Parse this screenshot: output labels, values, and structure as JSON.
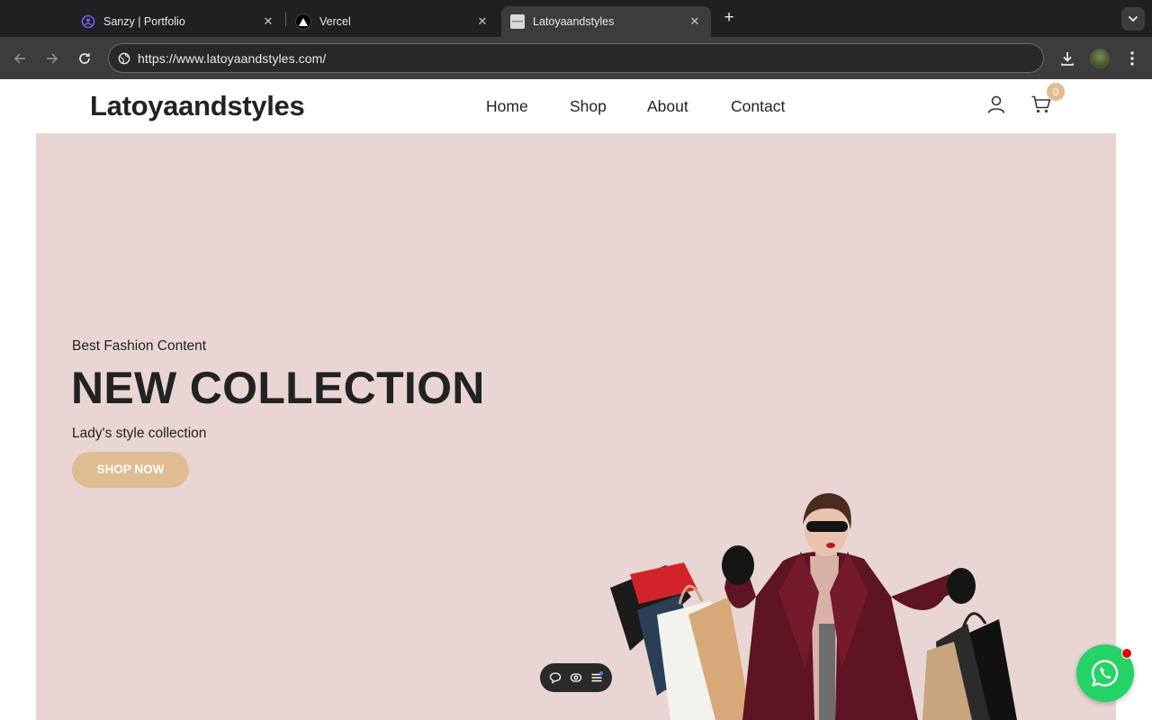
{
  "browser": {
    "tabs": [
      {
        "title": "Sanzy | Portfolio",
        "favicon": "portfolio-favicon-icon",
        "active": false
      },
      {
        "title": "Vercel",
        "favicon": "vercel-favicon-icon",
        "active": false
      },
      {
        "title": "Latoyaandstyles",
        "favicon": "page-favicon-icon",
        "active": true
      }
    ],
    "url": "https://www.latoyaandstyles.com/"
  },
  "site": {
    "logo": "Latoyaandstyles",
    "nav": [
      "Home",
      "Shop",
      "About",
      "Contact"
    ],
    "cart_count": "0",
    "accent_color": "#dfbc92",
    "hero_background": "#e9d6d4"
  },
  "hero": {
    "eyebrow": "Best Fashion Content",
    "headline": "NEW COLLECTION",
    "subtitle": "Lady's style collection",
    "cta": "SHOP NOW"
  },
  "widgets": {
    "floating_toolbar_icons": [
      "comment-icon",
      "view-icon",
      "menu-list-icon"
    ],
    "chat_button_icon": "whatsapp-icon",
    "chat_color": "#25d366"
  }
}
